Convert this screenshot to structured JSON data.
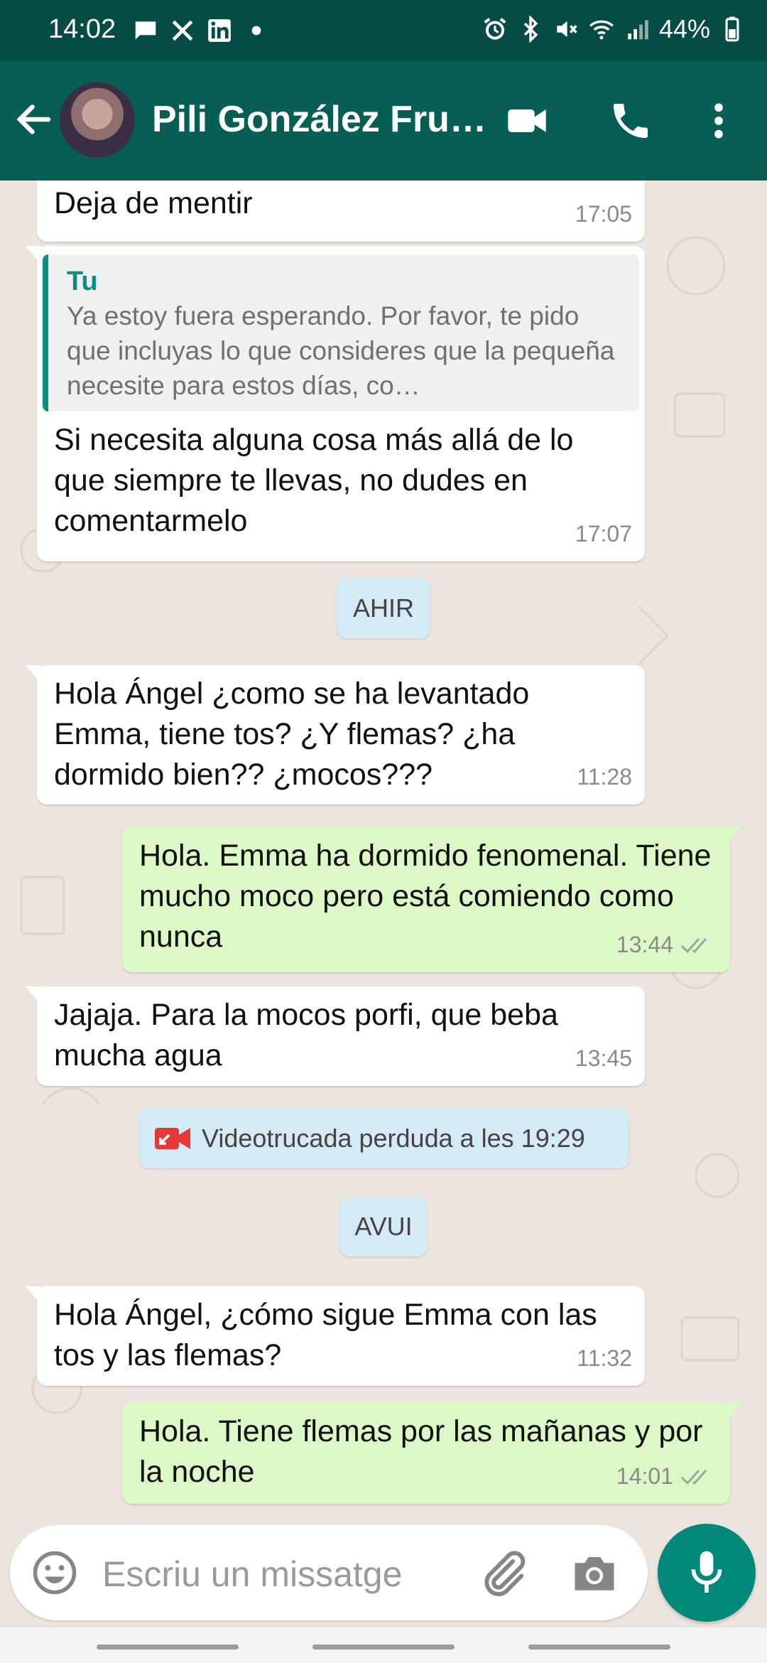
{
  "status_bar": {
    "time": "14:02",
    "battery": "44%"
  },
  "header": {
    "contact_name": "Pili González Fru…"
  },
  "messages": [
    {
      "dir": "in",
      "text": "Deja de mentir",
      "time": "17:05"
    },
    {
      "dir": "in",
      "quote_author": "Tu",
      "quote_text": "Ya estoy fuera esperando. Por favor, te pido que incluyas lo que consideres que la pequeña necesite para estos días, co…",
      "text": "Si necesita alguna cosa más allá  de lo que siempre te llevas,  no dudes en comentarmelo",
      "time": "17:07"
    },
    {
      "dir": "in",
      "text": "Hola Ángel ¿como se ha levantado Emma,  tiene tos? ¿Y flemas? ¿ha dormido bien?? ¿mocos???",
      "time": "11:28"
    },
    {
      "dir": "out",
      "text": "Hola. Emma ha dormido fenomenal. Tiene mucho moco pero está comiendo como nunca",
      "time": "13:44"
    },
    {
      "dir": "in",
      "text": "Jajaja. Para la mocos porfi, que beba mucha agua",
      "time": "13:45"
    },
    {
      "dir": "in",
      "text": "Hola Ángel,  ¿cómo sigue Emma con las tos y las flemas?",
      "time": "11:32"
    },
    {
      "dir": "out",
      "text": "Hola. Tiene flemas por las mañanas y por la noche",
      "time": "14:01"
    }
  ],
  "date_dividers": {
    "yesterday": "AHIR",
    "today": "AVUI"
  },
  "missed_call": {
    "text": "Videotrucada perduda a les 19:29"
  },
  "composer": {
    "placeholder": "Escriu un missatge"
  },
  "colors": {
    "header": "#075e54",
    "status_bar": "#054d44",
    "outgoing_bubble": "#dcf8c6",
    "incoming_bubble": "#ffffff",
    "accent": "#00897b",
    "missed_call": "#e53935"
  }
}
